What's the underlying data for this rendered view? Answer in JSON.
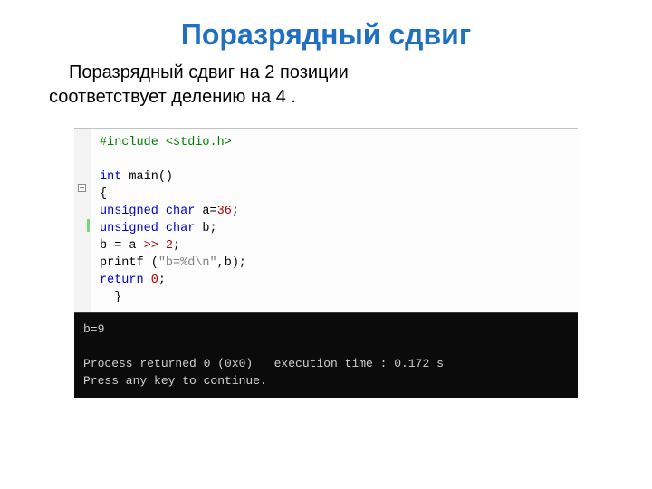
{
  "title": "Поразрядный сдвиг",
  "description_line1": "Поразрядный сдвиг на 2 позиции",
  "description_line2": "соответствует делению на 4 .",
  "code": {
    "include": "#include <stdio.h>",
    "int": "int",
    "main_sig": " main()",
    "brace_open": "{",
    "unsigned": "unsigned",
    "char": "char",
    "decl_a_name": " a",
    "eq": "=",
    "lit36": "36",
    "semi": ";",
    "decl_b": " b;",
    "assign_lhs": "b = a ",
    "shift_op": ">>",
    "space": " ",
    "lit2": "2",
    "printf_name": "printf",
    "printf_open": " (",
    "printf_str": "\"b=%d\\n\"",
    "printf_rest": ",b);",
    "return": "return",
    "lit0": "0",
    "brace_close": "}"
  },
  "console": {
    "line1": "b=9",
    "line2": "",
    "line3": "Process returned 0 (0x0)   execution time : 0.172 s",
    "line4": "Press any key to continue."
  }
}
